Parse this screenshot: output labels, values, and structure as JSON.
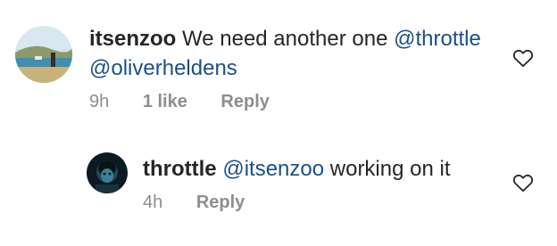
{
  "comments": [
    {
      "username": "itsenzoo",
      "text_segments": [
        {
          "type": "text",
          "value": "We need another one "
        },
        {
          "type": "mention",
          "value": "@throttle"
        },
        {
          "type": "mention",
          "value": "@oliverheldens"
        }
      ],
      "time": "9h",
      "likes": "1 like",
      "reply": "Reply",
      "like_icon": "heart-outline-icon"
    },
    {
      "username": "throttle",
      "text_segments": [
        {
          "type": "mention",
          "value": "@itsenzoo"
        },
        {
          "type": "text",
          "value": " working on it"
        }
      ],
      "time": "4h",
      "reply": "Reply",
      "like_icon": "heart-outline-icon"
    }
  ],
  "colors": {
    "text": "#262626",
    "mention": "#1a4f8b",
    "meta": "#8e8e8e"
  }
}
